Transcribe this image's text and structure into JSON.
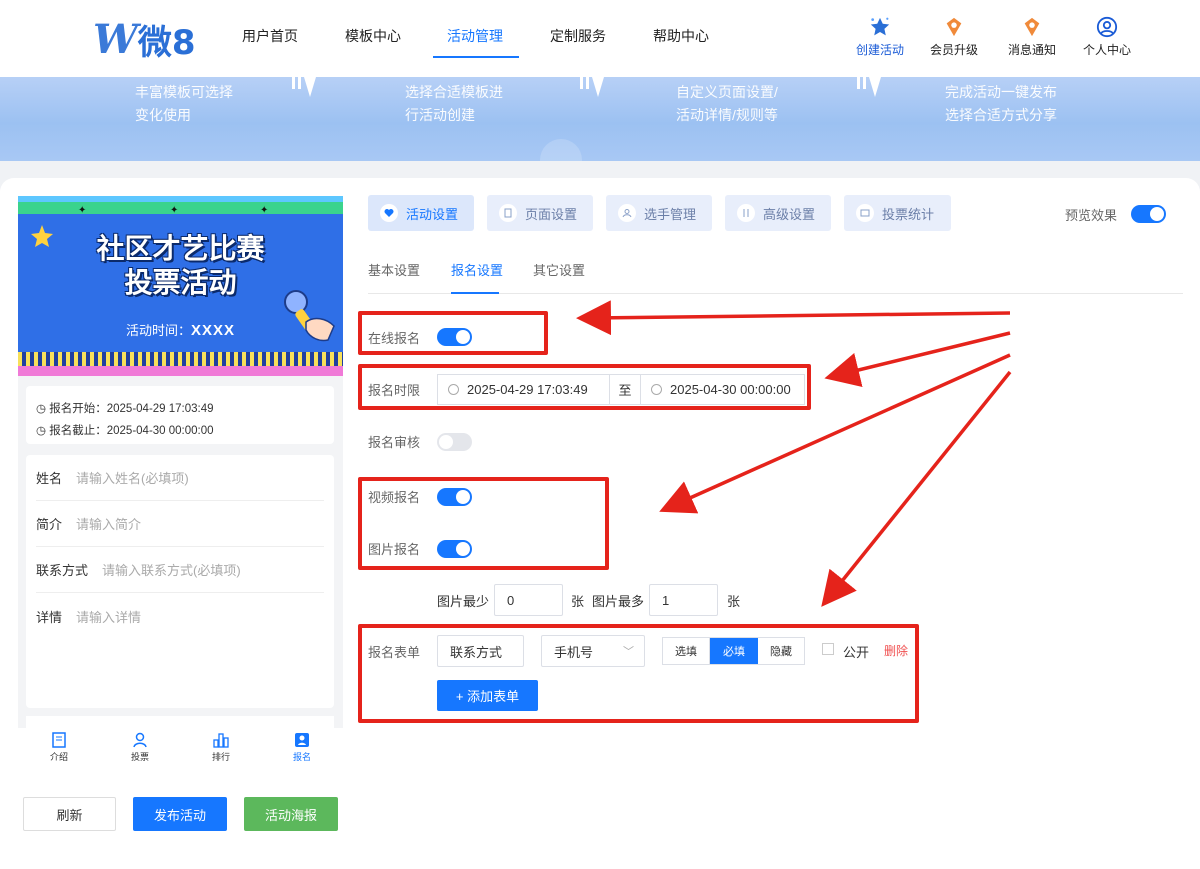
{
  "brand": {
    "logo_text": "微8"
  },
  "nav": {
    "items": [
      "用户首页",
      "模板中心",
      "活动管理",
      "定制服务",
      "帮助中心"
    ],
    "active": "活动管理"
  },
  "tools": {
    "create": "创建活动",
    "upgrade": "会员升级",
    "notify": "消息通知",
    "profile": "个人中心"
  },
  "banner": {
    "steps": [
      {
        "l1": "丰富模板可选择",
        "l2": "变化使用"
      },
      {
        "l1": "选择合适模板进",
        "l2": "行活动创建"
      },
      {
        "l1": "自定义页面设置/",
        "l2": "活动详情/规则等"
      },
      {
        "l1": "完成活动一键发布",
        "l2": "选择合适方式分享"
      }
    ]
  },
  "preview": {
    "poster_title_1": "社区才艺比赛",
    "poster_title_2": "投票活动",
    "poster_time_label": "活动时间：",
    "poster_time_value": "XXXX",
    "signup_start": "报名开始：2025-04-29 17:03:49",
    "signup_end": "报名截止：2025-04-30 00:00:00",
    "fields": [
      {
        "label": "姓名",
        "placeholder": "请输入姓名(必填项)"
      },
      {
        "label": "简介",
        "placeholder": "请输入简介"
      },
      {
        "label": "联系方式",
        "placeholder": "请输入联系方式(必填项)"
      },
      {
        "label": "详情",
        "placeholder": "请输入详情"
      }
    ],
    "bottom_nav": [
      "介绍",
      "投票",
      "排行",
      "报名"
    ]
  },
  "actions": {
    "refresh": "刷新",
    "publish": "发布活动",
    "poster": "活动海报"
  },
  "settings": {
    "tabs": [
      "活动设置",
      "页面设置",
      "选手管理",
      "高级设置",
      "投票统计"
    ],
    "preview_label": "预览效果",
    "subtabs": [
      "基本设置",
      "报名设置",
      "其它设置"
    ],
    "online_signup": "在线报名",
    "signup_period": "报名时限",
    "start_time": "2025-04-29 17:03:49",
    "to": "至",
    "end_time": "2025-04-30 00:00:00",
    "signup_review": "报名审核",
    "video_signup": "视频报名",
    "image_signup": "图片报名",
    "img_min_label": "图片最少",
    "img_min": "0",
    "unit": "张",
    "img_max_label": "图片最多",
    "img_max": "1",
    "form_label": "报名表单",
    "form_field": "联系方式",
    "form_type": "手机号",
    "opt_optional": "选填",
    "opt_required": "必填",
    "opt_hidden": "隐藏",
    "public": "公开",
    "delete": "删除",
    "add_form": "+ 添加表单"
  },
  "colors": {
    "accent": "#1677ff",
    "annotation": "#e5231b",
    "poster_green_btn": "#5cb85c"
  }
}
